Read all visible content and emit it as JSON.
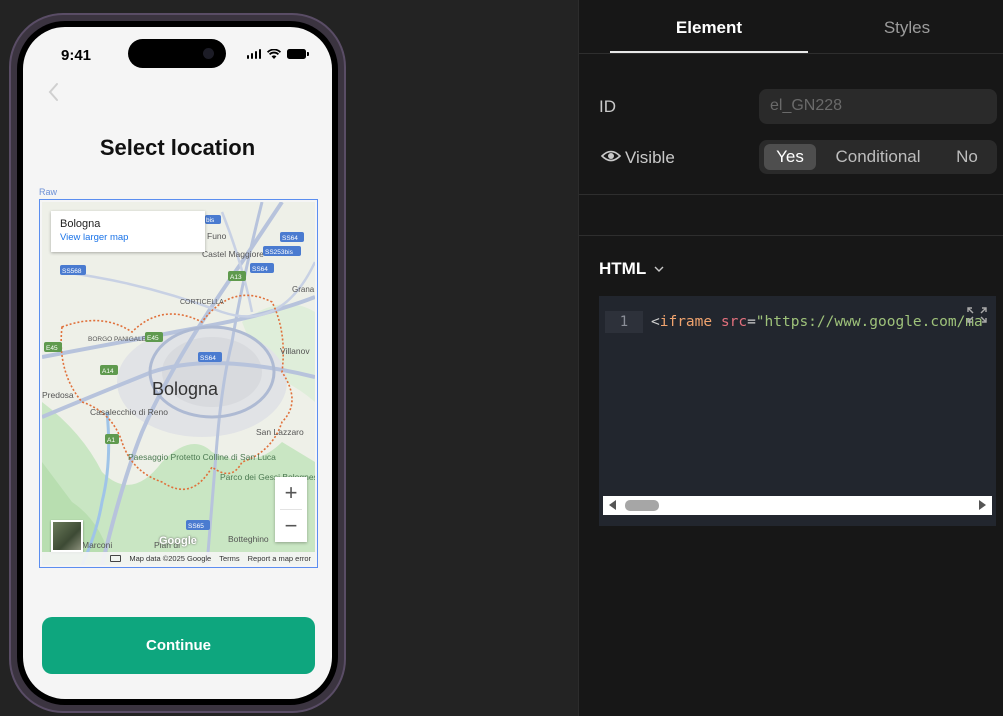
{
  "phone": {
    "status_time": "9:41",
    "title": "Select location",
    "raw_label": "Raw",
    "continue_label": "Continue"
  },
  "map": {
    "place_name": "Bologna",
    "larger_map_link": "View larger map",
    "city_label": "Bologna",
    "labels": {
      "castel_maggiore": "Castel Maggiore",
      "funo": "Funo",
      "corticella": "CORTICELLA",
      "borgo_panigale": "BORGO PANIGALE",
      "predosa": "Predosa",
      "casalecchio": "Casalecchio di Reno",
      "villanova": "Villanov",
      "san_lazzaro": "San Lazzaro",
      "paesaggio": "Paesaggio Protetto Colline di San Luca",
      "parco": "Parco dei Gessi Bolognesi e Calanchi dell'Abbadessa",
      "granarolo": "Grana dell'E",
      "botteghino": "Botteghino",
      "marconi": "Marconi",
      "pian": "Pian di"
    },
    "shields": [
      "SS568",
      "SS64",
      "SS253bis",
      "SS64",
      "A13",
      "E45",
      "E45",
      "A14",
      "SS64",
      "A1",
      "SS65",
      "bis"
    ],
    "zoom_in": "+",
    "zoom_out": "−",
    "google": "Google",
    "footer_data": "Map data ©2025 Google",
    "footer_terms": "Terms",
    "footer_report": "Report a map error"
  },
  "panel": {
    "tabs": [
      "Element",
      "Styles"
    ],
    "active_tab": "Element",
    "id_label": "ID",
    "id_placeholder": "el_GN228",
    "visible_label": "Visible",
    "visible_options": [
      "Yes",
      "Conditional",
      "No"
    ],
    "visible_selected": "Yes",
    "html_heading": "HTML",
    "code": {
      "line_number": "1",
      "open": "<",
      "tag": "iframe",
      "attr": "src",
      "eq": "=",
      "value": "\"https://www.google.com/ma"
    }
  },
  "colors": {
    "accent": "#0ea67e",
    "panel_bg": "#171717",
    "canvas_bg": "#232323"
  }
}
